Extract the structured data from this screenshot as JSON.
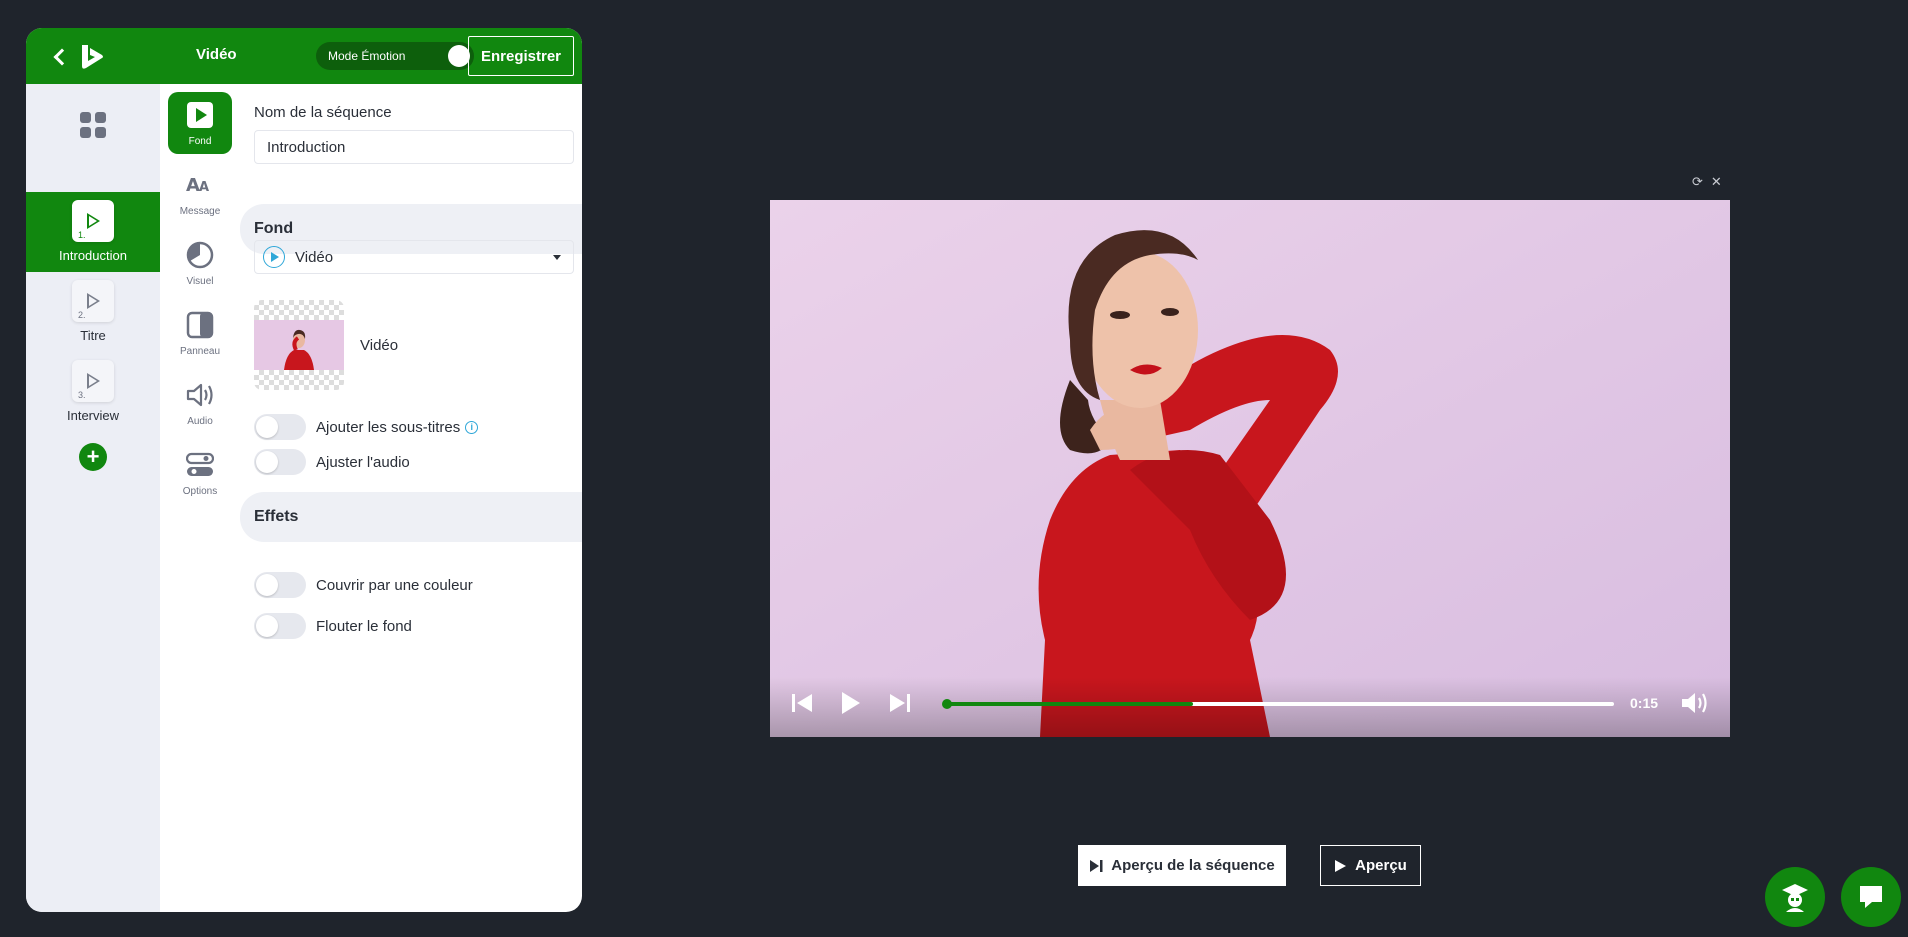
{
  "header": {
    "title": "Vidéo",
    "mode_label": "Mode Émotion",
    "save_label": "Enregistrer"
  },
  "sequences": [
    {
      "num": "1.",
      "label": "Introduction",
      "active": true
    },
    {
      "num": "2.",
      "label": "Titre",
      "active": false
    },
    {
      "num": "3.",
      "label": "Interview",
      "active": false
    }
  ],
  "tools": [
    {
      "label": "Fond",
      "icon": "play-square-icon",
      "active": true
    },
    {
      "label": "Message",
      "icon": "text-aa-icon",
      "active": false
    },
    {
      "label": "Visuel",
      "icon": "visual-circle-icon",
      "active": false
    },
    {
      "label": "Panneau",
      "icon": "panel-icon",
      "active": false
    },
    {
      "label": "Audio",
      "icon": "speaker-icon",
      "active": false
    },
    {
      "label": "Options",
      "icon": "options-toggles-icon",
      "active": false
    }
  ],
  "form": {
    "name_label": "Nom de la séquence",
    "name_value": "Introduction",
    "fond_heading": "Fond",
    "background_type": "Vidéo",
    "media_label": "Vidéo",
    "subtitles_label": "Ajouter les sous-titres",
    "subtitles_info_glyph": "i",
    "audio_label": "Ajuster l'audio",
    "effects_heading": "Effets",
    "cover_color_label": "Couvrir par une couleur",
    "blur_label": "Flouter le fond"
  },
  "player": {
    "time": "0:15",
    "progress": 0.37,
    "refresh_glyph": "⟳",
    "close_glyph": "✕"
  },
  "preview": {
    "sequence_preview_label": "Aperçu de la séquence",
    "preview_label": "Aperçu"
  },
  "colors": {
    "brand_green": "#11870f",
    "background": "#1f242c",
    "info_blue": "#2fa7d8"
  }
}
